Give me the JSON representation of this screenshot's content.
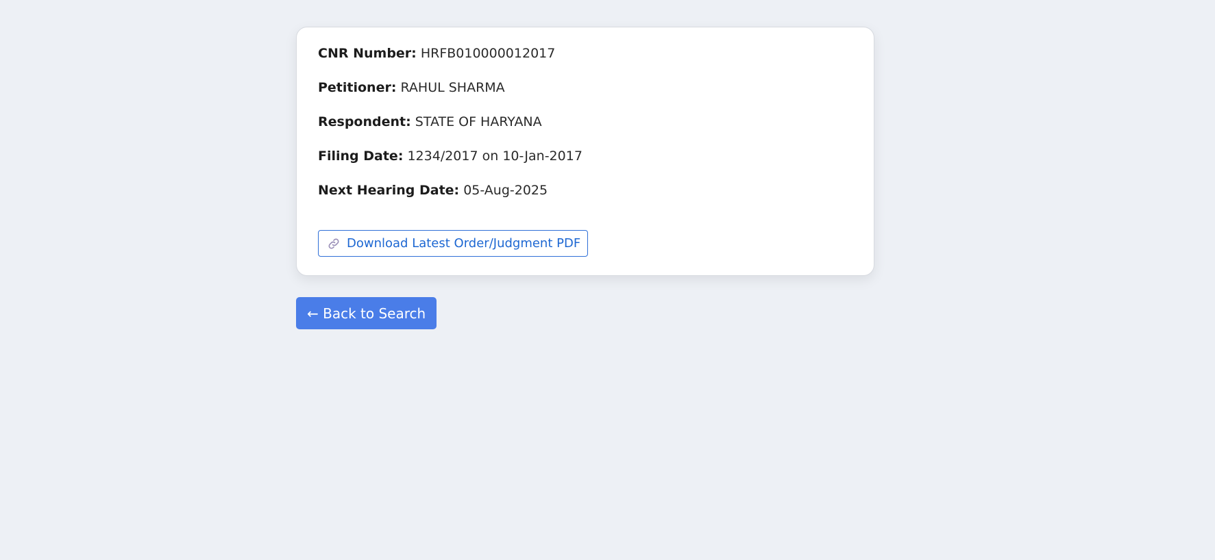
{
  "case": {
    "cnr": {
      "label": "CNR Number:",
      "value": "HRFB010000012017"
    },
    "petitioner": {
      "label": "Petitioner:",
      "value": "RAHUL SHARMA"
    },
    "respondent": {
      "label": "Respondent:",
      "value": "STATE OF HARYANA"
    },
    "filing_date": {
      "label": "Filing Date:",
      "value": "1234/2017 on 10-Jan-2017"
    },
    "next_hearing": {
      "label": "Next Hearing Date:",
      "value": "05-Aug-2025"
    }
  },
  "download": {
    "icon": "link-icon",
    "label": "Download Latest Order/Judgment PDF"
  },
  "back": {
    "label": "← Back to Search"
  },
  "colors": {
    "background": "#edf0f5",
    "card": "#ffffff",
    "link": "#1d67d2",
    "primary_button": "#4a7de8"
  }
}
